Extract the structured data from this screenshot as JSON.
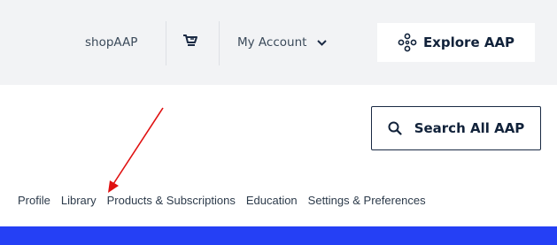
{
  "topbar": {
    "shop_label": "shopAAP",
    "cart_icon": "cart-icon",
    "account_label": "My Account",
    "account_icon": "chevron-down-icon",
    "explore_label": "Explore AAP",
    "explore_icon": "network-icon"
  },
  "search": {
    "label": "Search All AAP",
    "icon": "search-icon"
  },
  "subnav": {
    "items": [
      {
        "label": "Profile"
      },
      {
        "label": "Library"
      },
      {
        "label": "Products & Subscriptions"
      },
      {
        "label": "Education"
      },
      {
        "label": "Settings & Preferences"
      }
    ]
  },
  "colors": {
    "topbar_bg": "#f2f3f5",
    "text": "#3b4a5a",
    "accent_blue": "#2540f5",
    "annotation_red": "#e01010"
  }
}
